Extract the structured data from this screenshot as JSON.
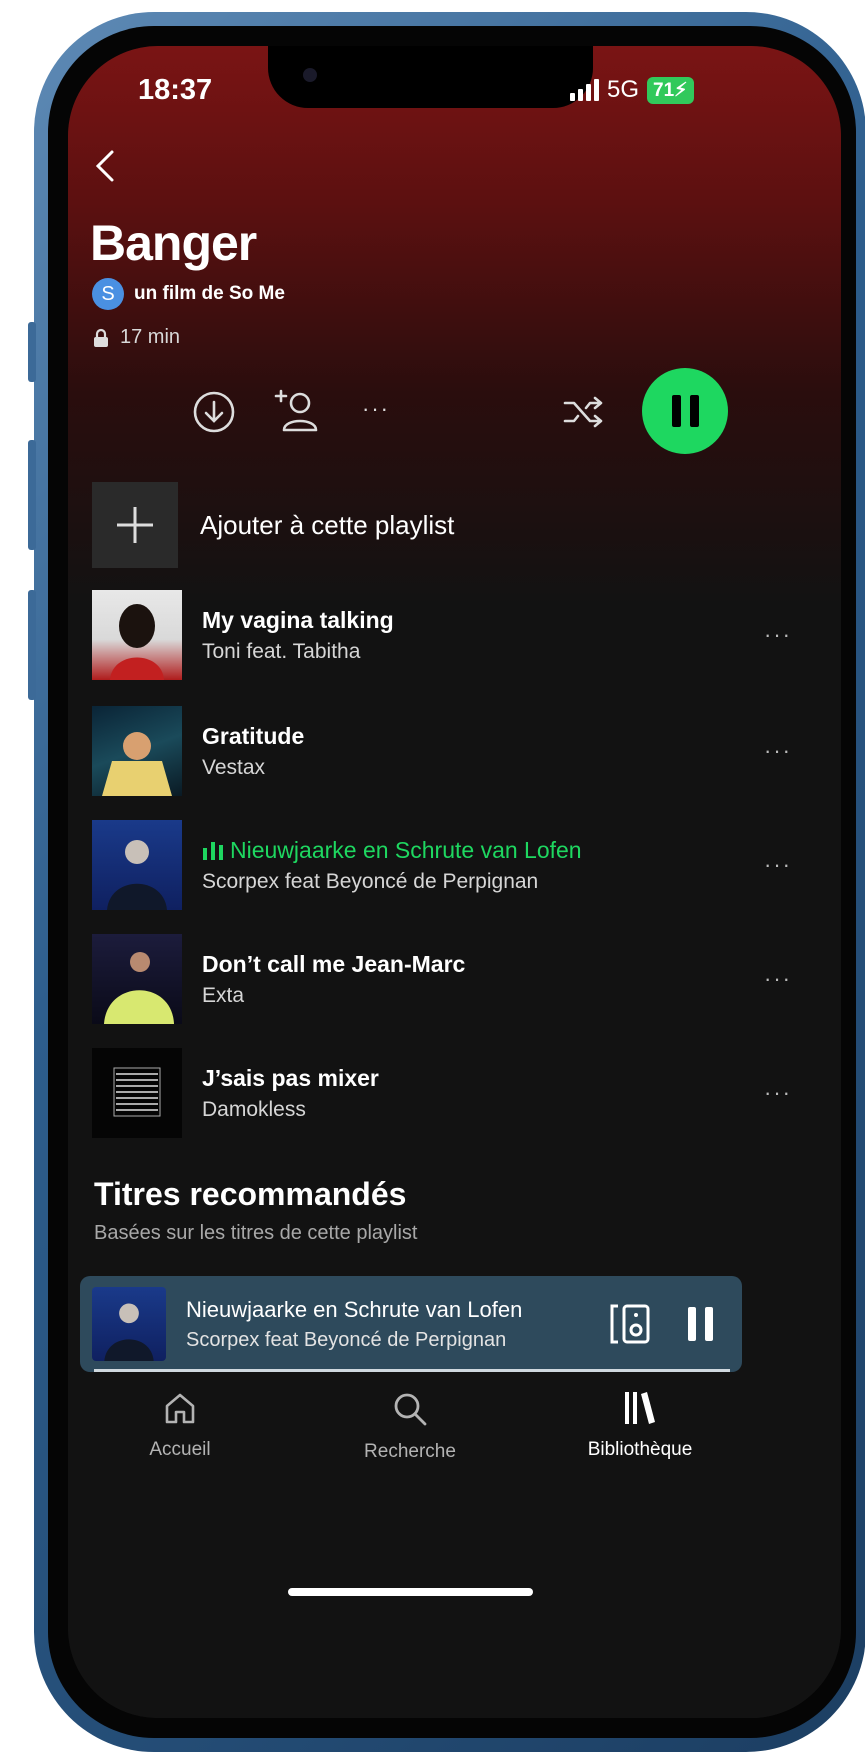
{
  "status": {
    "time": "18:37",
    "network": "5G",
    "battery": "71"
  },
  "playlist": {
    "title": "Banger",
    "owner_initial": "S",
    "owner_name": "un film de So Me",
    "duration": "17 min"
  },
  "actions": {
    "add_to_playlist": "Ajouter à cette playlist",
    "more": "···"
  },
  "tracks": [
    {
      "title": "My vagina talking",
      "artist": "Toni feat. Tabitha",
      "playing": false
    },
    {
      "title": "Gratitude",
      "artist": "Vestax",
      "playing": false
    },
    {
      "title": "Nieuwjaarke en Schrute van Lofen",
      "artist": "Scorpex feat Beyoncé de Perpignan",
      "playing": true
    },
    {
      "title": "Don’t call me Jean-Marc",
      "artist": "Exta",
      "playing": false
    },
    {
      "title": "J’sais pas mixer",
      "artist": "Damokless",
      "playing": false
    }
  ],
  "recommended": {
    "title": "Titres recommandés",
    "subtitle": "Basées sur les titres de cette playlist"
  },
  "now_playing": {
    "title": "Nieuwjaarke en Schrute van Lofen",
    "artist": "Scorpex feat Beyoncé de Perpignan"
  },
  "nav": {
    "home": "Accueil",
    "search": "Recherche",
    "library": "Bibliothèque"
  },
  "colors": {
    "accent": "#1ed760",
    "header": "#7a1414",
    "miniplayer": "#2e4a5c"
  }
}
